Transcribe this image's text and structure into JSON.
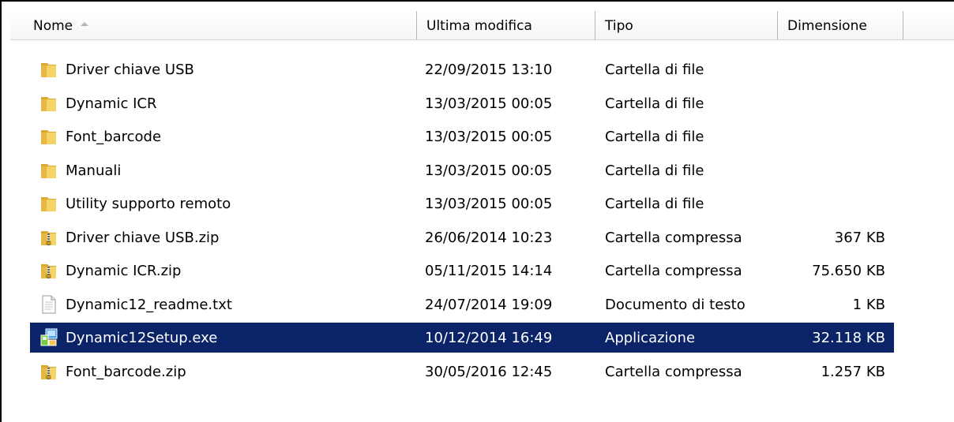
{
  "columns": {
    "name": "Nome",
    "modified": "Ultima modifica",
    "type": "Tipo",
    "size": "Dimensione"
  },
  "colors": {
    "selection": "#0b2467",
    "folder": "#f2c94c"
  },
  "files": [
    {
      "name": "Driver chiave USB",
      "modified": "22/09/2015 13:10",
      "type": "Cartella di file",
      "size": "",
      "icon": "folder-icon",
      "selected": false
    },
    {
      "name": "Dynamic ICR",
      "modified": "13/03/2015 00:05",
      "type": "Cartella di file",
      "size": "",
      "icon": "folder-icon",
      "selected": false
    },
    {
      "name": "Font_barcode",
      "modified": "13/03/2015 00:05",
      "type": "Cartella di file",
      "size": "",
      "icon": "folder-icon",
      "selected": false
    },
    {
      "name": "Manuali",
      "modified": "13/03/2015 00:05",
      "type": "Cartella di file",
      "size": "",
      "icon": "folder-icon",
      "selected": false
    },
    {
      "name": "Utility supporto remoto",
      "modified": "13/03/2015 00:05",
      "type": "Cartella di file",
      "size": "",
      "icon": "folder-icon",
      "selected": false
    },
    {
      "name": "Driver chiave USB.zip",
      "modified": "26/06/2014 10:23",
      "type": "Cartella compressa",
      "size": "367 KB",
      "icon": "zip-folder-icon",
      "selected": false
    },
    {
      "name": "Dynamic ICR.zip",
      "modified": "05/11/2015 14:14",
      "type": "Cartella compressa",
      "size": "75.650 KB",
      "icon": "zip-folder-icon",
      "selected": false
    },
    {
      "name": "Dynamic12_readme.txt",
      "modified": "24/07/2014 19:09",
      "type": "Documento di testo",
      "size": "1 KB",
      "icon": "text-file-icon",
      "selected": false
    },
    {
      "name": "Dynamic12Setup.exe",
      "modified": "10/12/2014 16:49",
      "type": "Applicazione",
      "size": "32.118 KB",
      "icon": "setup-exe-icon",
      "selected": true
    },
    {
      "name": "Font_barcode.zip",
      "modified": "30/05/2016 12:45",
      "type": "Cartella compressa",
      "size": "1.257 KB",
      "icon": "zip-folder-icon",
      "selected": false
    }
  ]
}
